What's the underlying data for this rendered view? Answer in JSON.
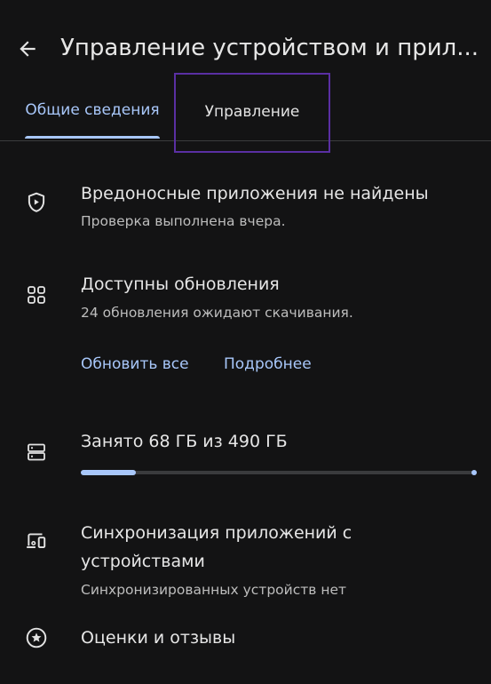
{
  "header": {
    "title": "Управление устройством и прил...",
    "back_icon": "arrow-back-icon"
  },
  "tabs": [
    {
      "label": "Общие сведения",
      "selected": true
    },
    {
      "label": "Управление",
      "selected": false
    }
  ],
  "colors": {
    "background": "#131314",
    "accent": "#a8c7fa",
    "text_primary": "#e6e6e6",
    "text_secondary": "#bdbdbd",
    "highlight_box": "#5a2fa3"
  },
  "protect": {
    "icon": "shield-play-icon",
    "title": "Вредоносные приложения не найдены",
    "subtitle": "Проверка выполнена вчера."
  },
  "updates": {
    "icon": "apps-grid-icon",
    "title": "Доступны обновления",
    "subtitle": "24 обновления ожидают скачивания.",
    "update_all": "Обновить все",
    "details": "Подробнее"
  },
  "storage": {
    "icon": "storage-icon",
    "title": "Занято 68 ГБ из 490 ГБ",
    "used_fraction": 0.139
  },
  "sync": {
    "icon": "devices-icon",
    "title": "Синхронизация приложений с устройствами",
    "subtitle": "Синхронизированных устройств нет"
  },
  "ratings": {
    "icon": "star-circle-icon",
    "title": "Оценки и отзывы"
  }
}
